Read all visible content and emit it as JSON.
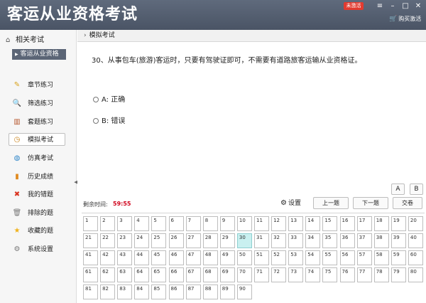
{
  "app": {
    "title": "客运从业资格考试",
    "activation_badge": "未激活",
    "buy_label": "购买激活",
    "cart_icon": "cart-icon"
  },
  "sidebar": {
    "header": "相关考试",
    "sub_item": "客运从业资格",
    "items": [
      {
        "label": "章节练习",
        "icon": "pencil-icon"
      },
      {
        "label": "筛选练习",
        "icon": "magnifier-icon"
      },
      {
        "label": "套题练习",
        "icon": "books-icon"
      },
      {
        "label": "模拟考试",
        "icon": "clock-icon"
      },
      {
        "label": "仿真考试",
        "icon": "earth-icon"
      },
      {
        "label": "历史成绩",
        "icon": "bar-chart-icon"
      },
      {
        "label": "我的错题",
        "icon": "red-x-icon"
      },
      {
        "label": "排除的题",
        "icon": "trash-icon"
      },
      {
        "label": "收藏的题",
        "icon": "star-icon"
      },
      {
        "label": "系统设置",
        "icon": "gear-icon"
      }
    ],
    "active_index": 3
  },
  "main": {
    "breadcrumb": "模拟考试",
    "question": "30、从事包车(旅游)客运时，只要有驾驶证即可，不需要有道路旅客运输从业资格证。",
    "options": [
      {
        "label": "A: 正确"
      },
      {
        "label": "B: 错误"
      }
    ],
    "font_buttons": [
      "A",
      "B"
    ],
    "timer_label": "剩余时间:",
    "timer_value": "59:55",
    "settings_label": "设置",
    "prev_label": "上一题",
    "next_label": "下一题",
    "submit_label": "交卷",
    "question_count": 90,
    "current_question": 30
  },
  "colors": {
    "titlebar": "#4f5a6b",
    "active_sub": "#5b6576",
    "timer": "#d0021b",
    "current_cell": "#c9f0f0",
    "badge": "#e23a2f"
  }
}
